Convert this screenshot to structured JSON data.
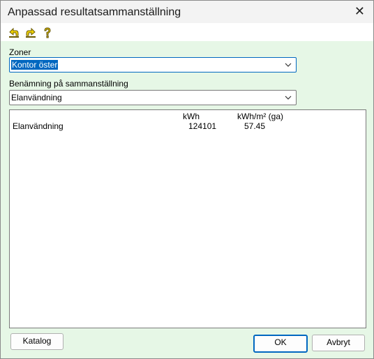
{
  "window": {
    "title": "Anpassad resultatsammanställning",
    "close_glyph": "✕"
  },
  "toolbar": {
    "icons": [
      "undo-icon",
      "redo-icon",
      "help-icon"
    ]
  },
  "zone": {
    "label": "Zoner",
    "value": "Kontor öster"
  },
  "summary_name": {
    "label": "Benämning på sammanställning",
    "value": "Elanvändning"
  },
  "results": {
    "columns": [
      "kWh",
      "kWh/m² (ga)"
    ],
    "rows": [
      {
        "name": "Elanvändning",
        "kwh": "124101",
        "kwh_per_m2": "57.45"
      }
    ]
  },
  "buttons": {
    "catalog": "Katalog",
    "ok": "OK",
    "cancel": "Avbryt"
  }
}
